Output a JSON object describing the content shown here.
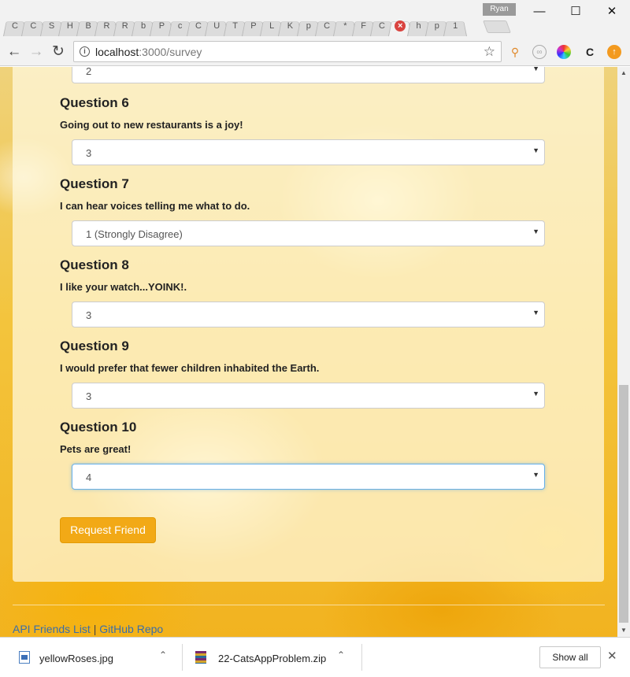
{
  "browser": {
    "profile_name": "Ryan",
    "tabs": [
      {
        "label": "C"
      },
      {
        "label": "C"
      },
      {
        "label": "S"
      },
      {
        "label": "H"
      },
      {
        "label": "B"
      },
      {
        "label": "R"
      },
      {
        "label": "R"
      },
      {
        "label": "b"
      },
      {
        "label": "P"
      },
      {
        "label": "c"
      },
      {
        "label": "C"
      },
      {
        "label": "U"
      },
      {
        "label": "T"
      },
      {
        "label": "P"
      },
      {
        "label": "L"
      },
      {
        "label": "K"
      },
      {
        "label": "p"
      },
      {
        "label": "C"
      },
      {
        "label": "*"
      },
      {
        "label": "F"
      },
      {
        "label": "C"
      },
      {
        "label": "×",
        "active": true
      },
      {
        "label": "h"
      },
      {
        "label": "p"
      },
      {
        "label": "1"
      }
    ],
    "window_controls": {
      "minimize": "—",
      "maximize": "☐",
      "close": "✕"
    },
    "url_host": "localhost",
    "url_rest": ":3000/survey"
  },
  "survey": {
    "prev_answer": "2",
    "questions": [
      {
        "title": "Question 6",
        "text": "Going out to new restaurants is a joy!",
        "answer": "3"
      },
      {
        "title": "Question 7",
        "text": "I can hear voices telling me what to do.",
        "answer": "1 (Strongly Disagree)"
      },
      {
        "title": "Question 8",
        "text": "I like your watch...YOINK!.",
        "answer": "3"
      },
      {
        "title": "Question 9",
        "text": "I would prefer that fewer children inhabited the Earth.",
        "answer": "3"
      },
      {
        "title": "Question 10",
        "text": "Pets are great!",
        "answer": "4"
      }
    ],
    "submit_label": "Request Friend"
  },
  "footer": {
    "link_api": "API Friends List",
    "separator": "|",
    "link_repo": "GitHub Repo"
  },
  "downloads": {
    "items": [
      {
        "name": "yellowRoses.jpg"
      },
      {
        "name": "22-CatsAppProblem.zip"
      }
    ],
    "show_all_label": "Show all"
  },
  "colors": {
    "accent": "#f2a916",
    "link": "#3a6ea8",
    "focus": "#66afe9"
  }
}
